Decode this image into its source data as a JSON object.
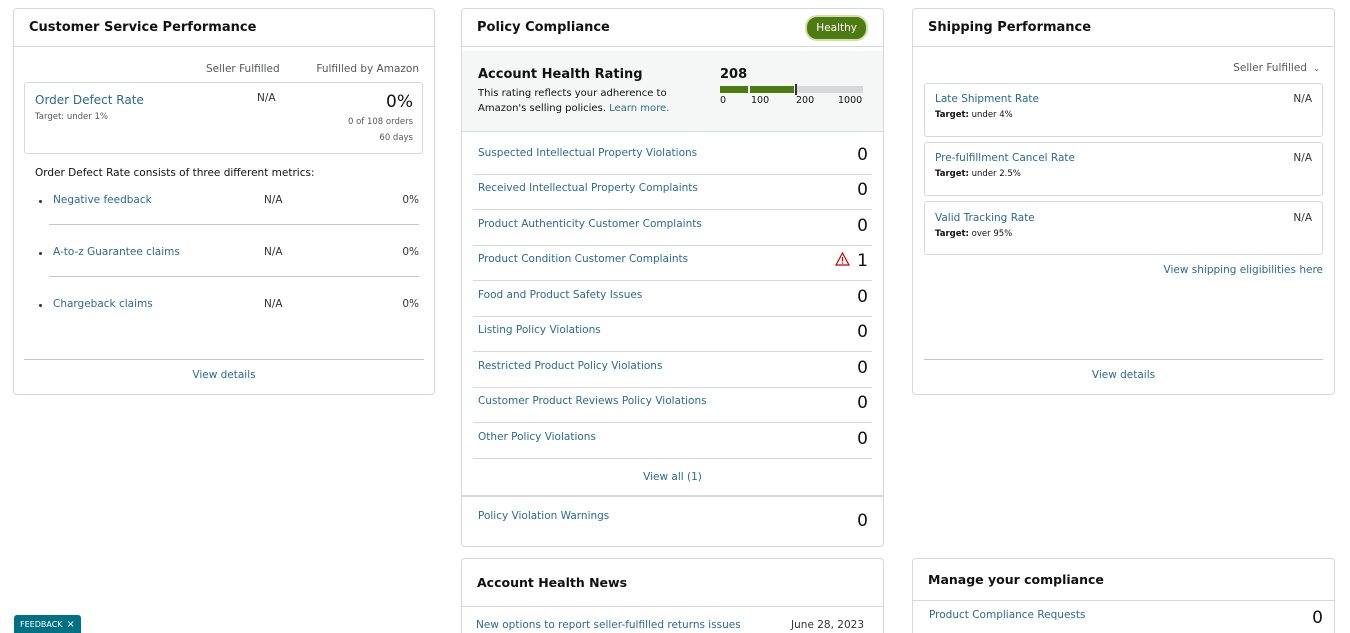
{
  "customer_service": {
    "title": "Customer Service Performance",
    "col_seller": "Seller Fulfilled",
    "col_amazon": "Fulfilled by Amazon",
    "odr": {
      "label": "Order Defect Rate",
      "target": "Target: under 1%",
      "seller_value": "N/A",
      "amazon_value": "0%",
      "orders": "0 of 108 orders",
      "period": "60 days"
    },
    "consists_text": "Order Defect Rate consists of three different metrics:",
    "metrics": [
      {
        "label": "Negative feedback",
        "seller": "N/A",
        "amazon": "0%"
      },
      {
        "label": "A-to-z Guarantee claims",
        "seller": "N/A",
        "amazon": "0%"
      },
      {
        "label": "Chargeback claims",
        "seller": "N/A",
        "amazon": "0%"
      }
    ],
    "view_details": "View details"
  },
  "policy_compliance": {
    "title": "Policy Compliance",
    "status_badge": "Healthy",
    "rating_title": "Account Health Rating",
    "rating_desc_1": "This rating reflects your adherence to",
    "rating_desc_2": "Amazon's selling policies.",
    "learn_more": "Learn more.",
    "rating_value": "208",
    "scale": [
      "0",
      "100",
      "200",
      "1000"
    ],
    "rating_fraction": 0.208,
    "rows": [
      {
        "label": "Suspected Intellectual Property Violations",
        "count": "0",
        "warning": false
      },
      {
        "label": "Received Intellectual Property Complaints",
        "count": "0",
        "warning": false
      },
      {
        "label": "Product Authenticity Customer Complaints",
        "count": "0",
        "warning": false
      },
      {
        "label": "Product Condition Customer Complaints",
        "count": "1",
        "warning": true
      },
      {
        "label": "Food and Product Safety Issues",
        "count": "0",
        "warning": false
      },
      {
        "label": "Listing Policy Violations",
        "count": "0",
        "warning": false
      },
      {
        "label": "Restricted Product Policy Violations",
        "count": "0",
        "warning": false
      },
      {
        "label": "Customer Product Reviews Policy Violations",
        "count": "0",
        "warning": false
      },
      {
        "label": "Other Policy Violations",
        "count": "0",
        "warning": false
      }
    ],
    "view_all": "View all (1)",
    "warnings_label": "Policy Violation Warnings",
    "warnings_count": "0",
    "colors": {
      "accent": "#4e7a12",
      "link": "#2b6a8e",
      "warning": "#c40000"
    }
  },
  "shipping": {
    "title": "Shipping Performance",
    "dropdown": "Seller Fulfilled",
    "metrics": [
      {
        "label": "Late Shipment Rate",
        "target_prefix": "Target:",
        "target": "under 4%",
        "value": "N/A"
      },
      {
        "label": "Pre-fulfillment Cancel Rate",
        "target_prefix": "Target:",
        "target": "under 2.5%",
        "value": "N/A"
      },
      {
        "label": "Valid Tracking Rate",
        "target_prefix": "Target:",
        "target": "over 95%",
        "value": "N/A"
      }
    ],
    "eligibility_link": "View shipping eligibilities here",
    "view_details": "View details"
  },
  "news": {
    "title": "Account Health News",
    "item": "New options to report seller-fulfilled returns issues",
    "date": "June 28, 2023"
  },
  "manage": {
    "title": "Manage your compliance",
    "item": "Product Compliance Requests",
    "count": "0"
  },
  "feedback": {
    "label": "FEEDBACK",
    "close": "×"
  }
}
